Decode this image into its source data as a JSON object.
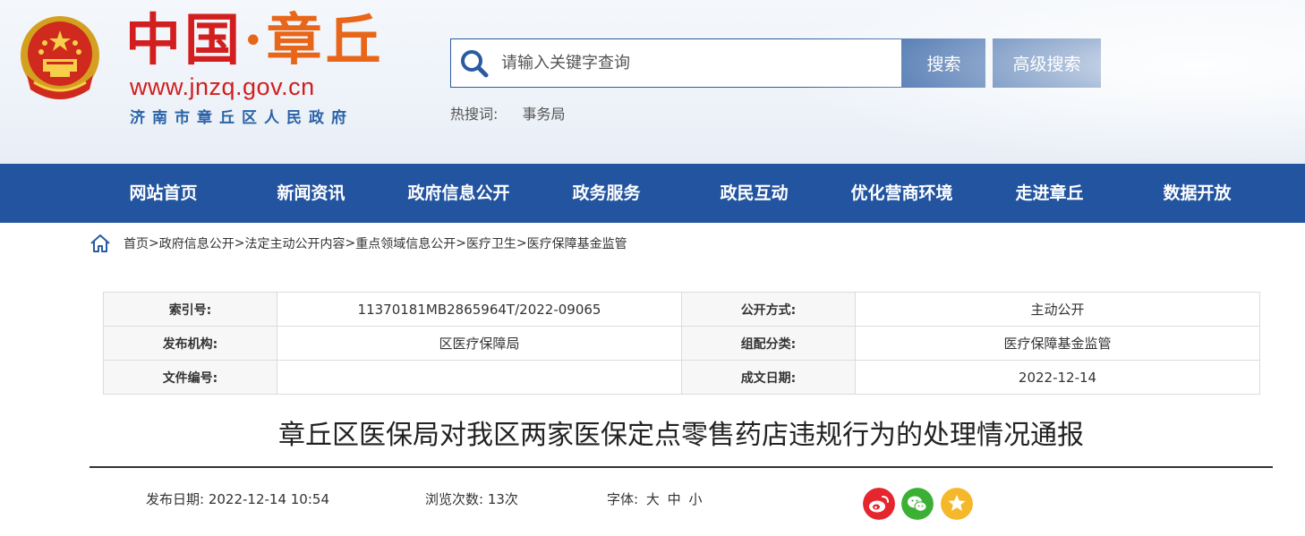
{
  "header": {
    "title_a": "中国",
    "title_dot": "·",
    "title_b": "章丘",
    "url": "www.jnzq.gov.cn",
    "subtitle": "济南市章丘区人民政府"
  },
  "search": {
    "placeholder": "请输入关键字查询",
    "search_label": "搜索",
    "advanced_label": "高级搜索",
    "hot_label": "热搜词:",
    "hot_words": [
      "事务局"
    ]
  },
  "nav": {
    "items": [
      "网站首页",
      "新闻资讯",
      "政府信息公开",
      "政务服务",
      "政民互动",
      "优化营商环境",
      "走进章丘",
      "数据开放"
    ]
  },
  "breadcrumb": {
    "items": [
      "首页",
      "政府信息公开",
      "法定主动公开内容",
      "重点领域信息公开",
      "医疗卫生",
      "医疗保障基金监管"
    ],
    "sep": ">"
  },
  "info": {
    "rows": [
      {
        "k1": "索引号:",
        "v1": "11370181MB2865964T/2022-09065",
        "k2": "公开方式:",
        "v2": "主动公开"
      },
      {
        "k1": "发布机构:",
        "v1": "区医疗保障局",
        "k2": "组配分类:",
        "v2": "医疗保障基金监管"
      },
      {
        "k1": "文件编号:",
        "v1": "",
        "k2": "成文日期:",
        "v2": "2022-12-14"
      }
    ]
  },
  "article": {
    "title": "章丘区医保局对我区两家医保定点零售药店违规行为的处理情况通报",
    "publish_date": "发布日期:  2022-12-14 10:54",
    "views": "浏览次数:  13次",
    "font_label": "字体:",
    "font_large": "大",
    "font_medium": "中",
    "font_small": "小"
  },
  "share": {
    "icons": [
      "weibo-icon",
      "wechat-icon",
      "favorite-icon"
    ],
    "colors": [
      "#e5262e",
      "#3cb034",
      "#f5b82a"
    ]
  },
  "colors": {
    "primary": "#2354a0",
    "brand_red": "#d21e1e",
    "brand_orange": "#e8661a"
  }
}
